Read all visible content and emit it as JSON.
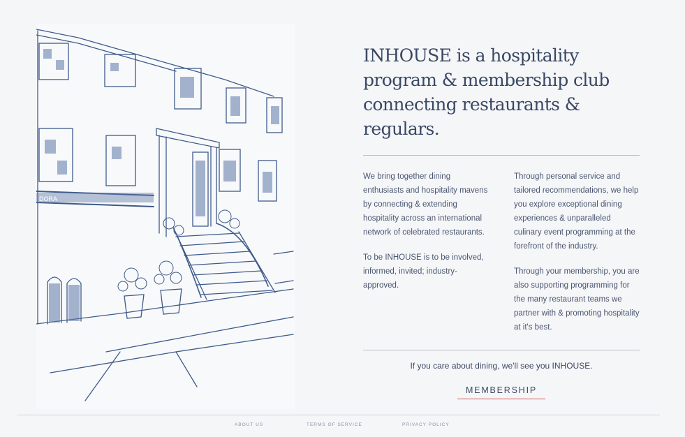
{
  "headline": "INHOUSE is a hospitality program & membership club connecting restaurants & regulars.",
  "columns": {
    "left": [
      "We bring together dining enthusiasts and hospitality mavens by connecting & extending hospitality across an international network of celebrated restaurants.",
      "To be INHOUSE is to be involved, informed, invited; industry-approved."
    ],
    "right": [
      "Through personal service and tailored recommendations, we help you explore exceptional dining experiences & unparalleled culinary event programming at the forefront of the industry.",
      "Through your membership, you are also supporting programming for the many restaurant teams we partner with & promoting hospitality at it's best."
    ]
  },
  "tagline": "If you care about dining, we'll see you INHOUSE.",
  "cta": {
    "label": "MEMBERSHIP"
  },
  "illustration": {
    "sign_text": "DORA"
  },
  "footer": {
    "links": [
      "ABOUT US",
      "TERMS OF SERVICE",
      "PRIVACY POLICY"
    ]
  },
  "colors": {
    "background": "#f5f6f8",
    "text": "#2c3a55",
    "ink": "#3f5a8a",
    "accent_underline": "#d0554f"
  }
}
